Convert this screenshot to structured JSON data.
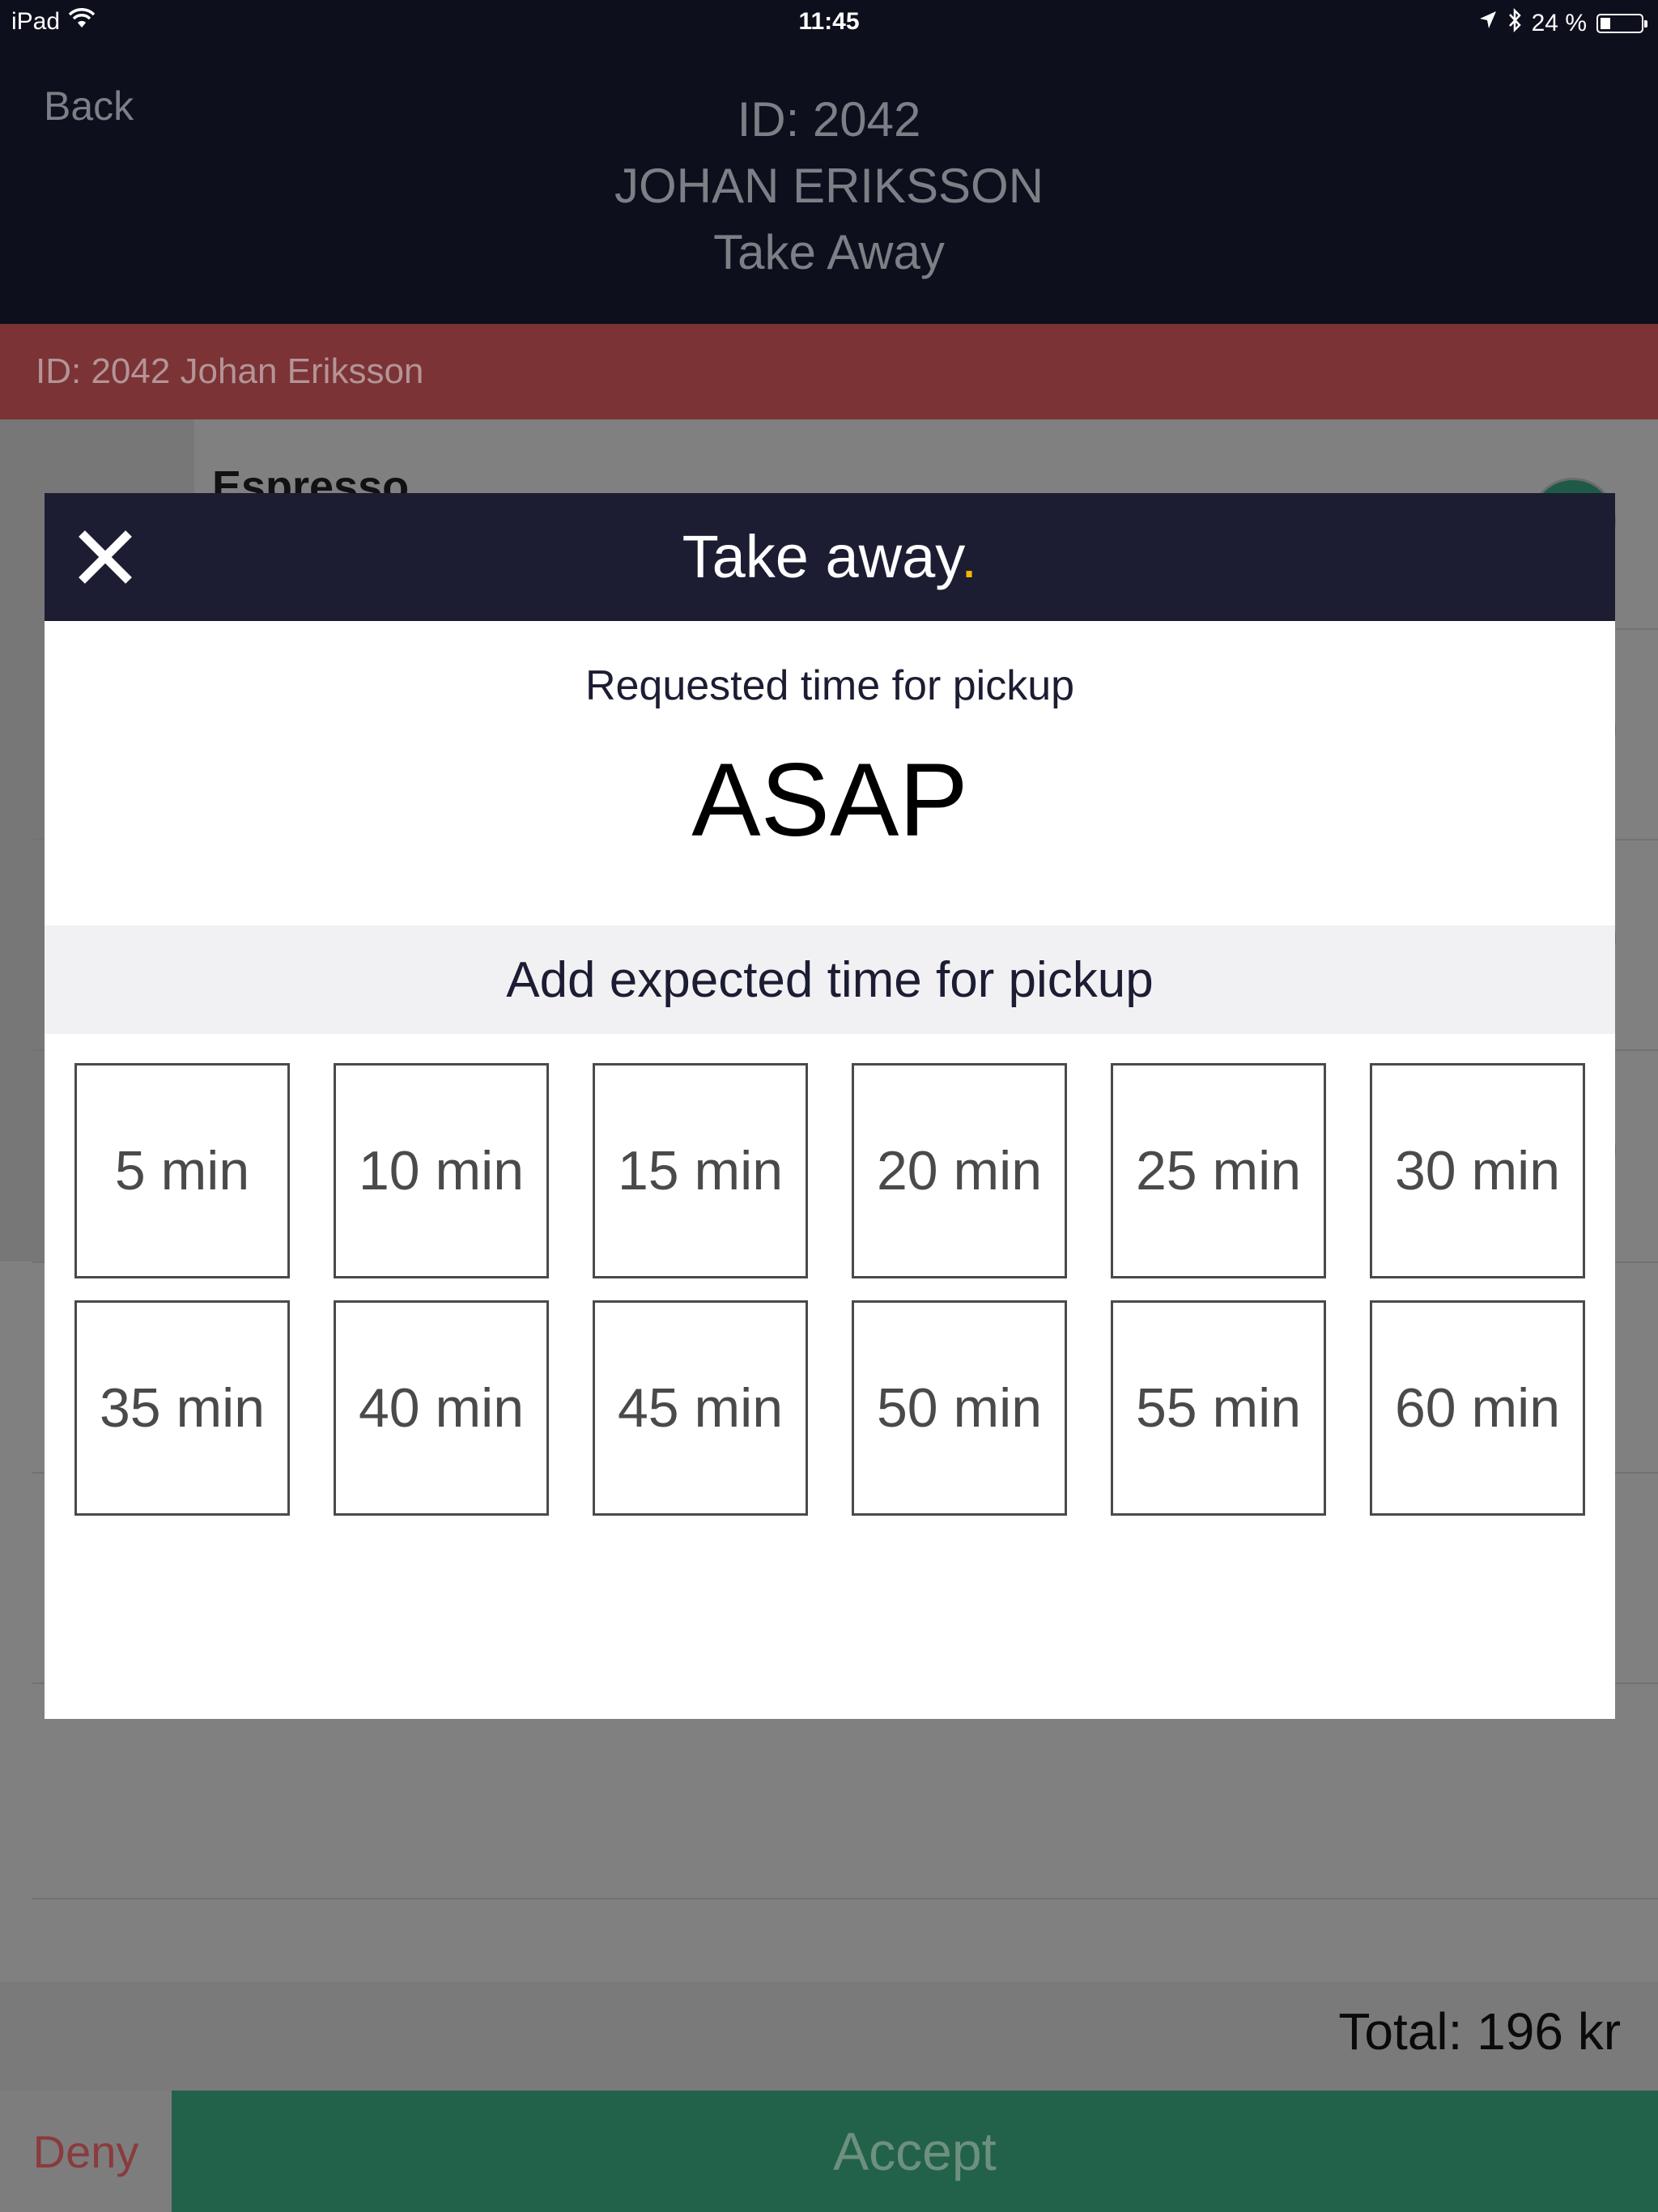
{
  "status_bar": {
    "device": "iPad",
    "time": "11:45",
    "battery_text": "24 %",
    "battery_level": 0.24,
    "icons": [
      "wifi-icon",
      "location-arrow-icon",
      "bluetooth-icon",
      "battery-icon"
    ]
  },
  "nav": {
    "back_label": "Back",
    "order_id": "ID: 2042",
    "customer_name": "JOHAN ERIKSSON",
    "order_type": "Take Away"
  },
  "order_banner": {
    "text": "ID: 2042 Johan Eriksson"
  },
  "order_items": [
    {
      "name": "Espresso"
    }
  ],
  "footer": {
    "total": "Total: 196 kr",
    "deny_label": "Deny",
    "accept_label": "Accept"
  },
  "modal": {
    "title": "Take away",
    "title_dot": ".",
    "close_icon": "close-icon",
    "requested_label": "Requested time for pickup",
    "requested_value": "ASAP",
    "expected_label": "Add expected time for pickup",
    "options": [
      "5 min",
      "10 min",
      "15 min",
      "20 min",
      "25 min",
      "30 min",
      "35 min",
      "40 min",
      "45 min",
      "50 min",
      "55 min",
      "60 min"
    ]
  },
  "colors": {
    "header_dark": "#0d0f1d",
    "modal_header": "#1c1d33",
    "banner_red": "#7b3336",
    "accept_green": "#23624a",
    "title_dot": "#f5b400"
  }
}
